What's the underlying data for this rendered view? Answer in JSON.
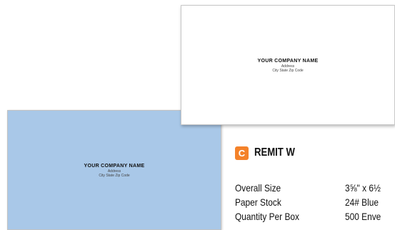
{
  "white_envelope": {
    "company": "YOUR COMPANY NAME",
    "address": "Address",
    "city_line": "City  State  Zip Code"
  },
  "blue_envelope": {
    "company": "YOUR COMPANY NAME",
    "address": "Address",
    "city_line": "City  State  Zip Code"
  },
  "product": {
    "badge": "C",
    "title": "REMIT W",
    "accent_color": "#f4822a",
    "envelope_blue": "#a9c8e8"
  },
  "specs": [
    {
      "label": "Overall Size",
      "value": "3⅝\" x 6½"
    },
    {
      "label": "Paper Stock",
      "value": "24# Blue"
    },
    {
      "label": "Quantity Per Box",
      "value": "500 Enve"
    }
  ]
}
